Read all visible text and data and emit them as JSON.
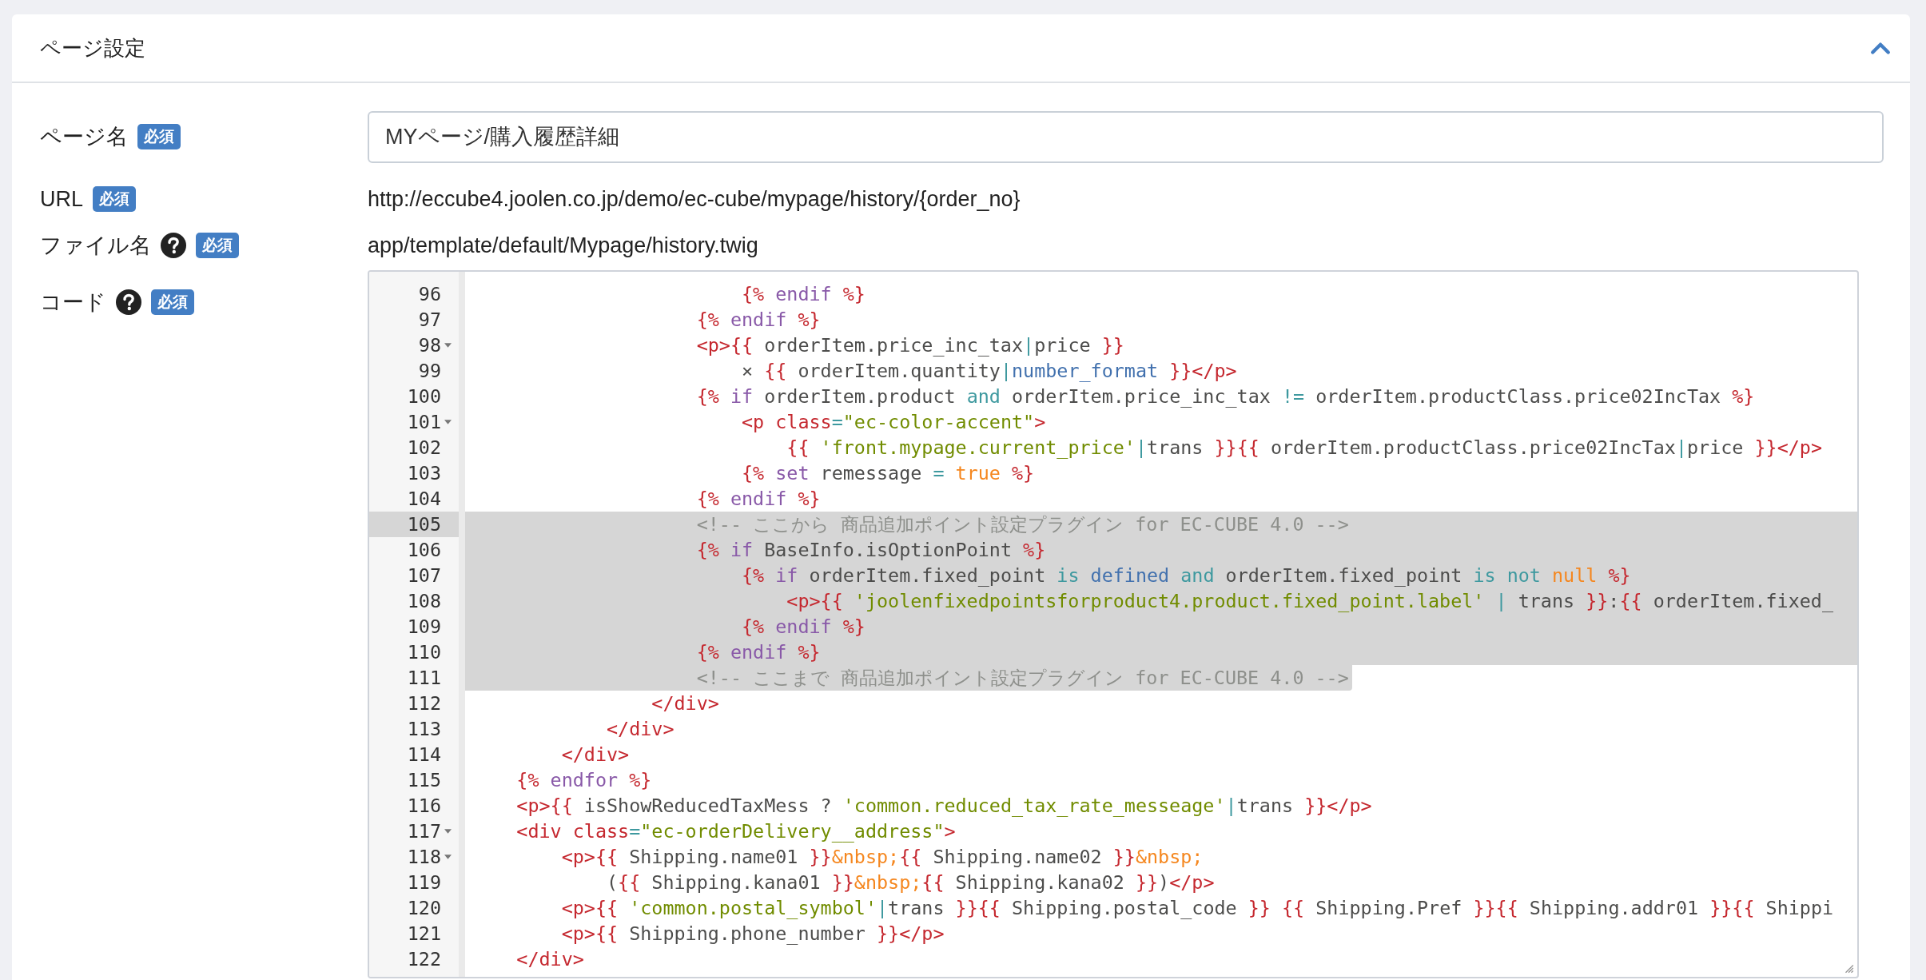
{
  "panel": {
    "title": "ページ設定",
    "expanded": true
  },
  "fields": [
    {
      "label": "ページ名",
      "help": false,
      "badge": "必須",
      "kind": "input",
      "value": "MYページ/購入履歴詳細"
    },
    {
      "label": "URL",
      "help": false,
      "badge": "必須",
      "kind": "text",
      "value": "http://eccube4.joolen.co.jp/demo/ec-cube/mypage/history/{order_no}"
    },
    {
      "label": "ファイル名",
      "help": true,
      "badge": "必須",
      "kind": "text",
      "value": "app/template/default/Mypage/history.twig"
    },
    {
      "label": "コード",
      "help": true,
      "badge": "必須",
      "kind": "code"
    }
  ],
  "editor": {
    "lines": [
      {
        "number": "96",
        "foldable": false,
        "active": false,
        "selected": false,
        "tokens": [
          {
            "kind": "tag",
            "text": "                        {%"
          },
          {
            "kind": "keyword",
            "text": " endif "
          },
          {
            "kind": "tag",
            "text": "%}"
          }
        ]
      },
      {
        "number": "97",
        "foldable": false,
        "active": false,
        "selected": false,
        "tokens": [
          {
            "kind": "tag",
            "text": "                    {%"
          },
          {
            "kind": "keyword",
            "text": " endif "
          },
          {
            "kind": "tag",
            "text": "%}"
          }
        ]
      },
      {
        "number": "98",
        "foldable": true,
        "active": false,
        "selected": false,
        "tokens": [
          {
            "kind": "tag",
            "text": "                    <p>{{"
          },
          {
            "kind": "plain",
            "text": " orderItem.price_inc_tax"
          },
          {
            "kind": "op",
            "text": "|"
          },
          {
            "kind": "plain",
            "text": "price "
          },
          {
            "kind": "tag",
            "text": "}}"
          }
        ]
      },
      {
        "number": "99",
        "foldable": false,
        "active": false,
        "selected": false,
        "tokens": [
          {
            "kind": "plain",
            "text": "                        × "
          },
          {
            "kind": "tag",
            "text": "{{"
          },
          {
            "kind": "plain",
            "text": " orderItem.quantity"
          },
          {
            "kind": "op",
            "text": "|"
          },
          {
            "kind": "filter",
            "text": "number_format"
          },
          {
            "kind": "tag",
            "text": " }}</p>"
          }
        ]
      },
      {
        "number": "100",
        "foldable": false,
        "active": false,
        "selected": false,
        "tokens": [
          {
            "kind": "tag",
            "text": "                    {%"
          },
          {
            "kind": "keyword",
            "text": " if "
          },
          {
            "kind": "plain",
            "text": "orderItem.product "
          },
          {
            "kind": "op",
            "text": "and"
          },
          {
            "kind": "plain",
            "text": " orderItem.price_inc_tax "
          },
          {
            "kind": "op",
            "text": "!="
          },
          {
            "kind": "plain",
            "text": " orderItem.productClass.price02IncTax "
          },
          {
            "kind": "tag",
            "text": "%}"
          }
        ]
      },
      {
        "number": "101",
        "foldable": true,
        "active": false,
        "selected": false,
        "tokens": [
          {
            "kind": "tag",
            "text": "                        <p class"
          },
          {
            "kind": "op",
            "text": "="
          },
          {
            "kind": "string",
            "text": "\"ec-color-accent\""
          },
          {
            "kind": "tag",
            "text": ">"
          }
        ]
      },
      {
        "number": "102",
        "foldable": false,
        "active": false,
        "selected": false,
        "tokens": [
          {
            "kind": "tag",
            "text": "                            {{"
          },
          {
            "kind": "string",
            "text": " 'front.mypage.current_price'"
          },
          {
            "kind": "op",
            "text": "|"
          },
          {
            "kind": "plain",
            "text": "trans "
          },
          {
            "kind": "tag",
            "text": "}}{{"
          },
          {
            "kind": "plain",
            "text": " orderItem.productClass.price02IncTax"
          },
          {
            "kind": "op",
            "text": "|"
          },
          {
            "kind": "plain",
            "text": "price "
          },
          {
            "kind": "tag",
            "text": "}}</p>"
          }
        ]
      },
      {
        "number": "103",
        "foldable": false,
        "active": false,
        "selected": false,
        "tokens": [
          {
            "kind": "tag",
            "text": "                        {%"
          },
          {
            "kind": "keyword",
            "text": " set "
          },
          {
            "kind": "plain",
            "text": "remessage "
          },
          {
            "kind": "op",
            "text": "="
          },
          {
            "kind": "const",
            "text": " true "
          },
          {
            "kind": "tag",
            "text": "%}"
          }
        ]
      },
      {
        "number": "104",
        "foldable": false,
        "active": false,
        "selected": false,
        "tokens": [
          {
            "kind": "tag",
            "text": "                    {%"
          },
          {
            "kind": "keyword",
            "text": " endif "
          },
          {
            "kind": "tag",
            "text": "%}"
          }
        ]
      },
      {
        "number": "105",
        "foldable": false,
        "active": true,
        "selected": true,
        "selection_to_line_end": true,
        "tokens": [
          {
            "kind": "comment",
            "text": "                    <!-- ここから 商品追加ポイント設定プラグイン for EC-CUBE 4.0 -->"
          }
        ]
      },
      {
        "number": "106",
        "foldable": false,
        "active": false,
        "selected": true,
        "selection_to_line_end": true,
        "tokens": [
          {
            "kind": "tag",
            "text": "                    {%"
          },
          {
            "kind": "keyword",
            "text": " if "
          },
          {
            "kind": "plain",
            "text": "BaseInfo.isOptionPoint "
          },
          {
            "kind": "tag",
            "text": "%}"
          }
        ]
      },
      {
        "number": "107",
        "foldable": false,
        "active": false,
        "selected": true,
        "selection_to_line_end": true,
        "tokens": [
          {
            "kind": "tag",
            "text": "                        {%"
          },
          {
            "kind": "keyword",
            "text": " if "
          },
          {
            "kind": "plain",
            "text": "orderItem.fixed_point "
          },
          {
            "kind": "op",
            "text": "is"
          },
          {
            "kind": "filter",
            "text": " defined "
          },
          {
            "kind": "op",
            "text": "and"
          },
          {
            "kind": "plain",
            "text": " orderItem.fixed_point "
          },
          {
            "kind": "op",
            "text": "is not"
          },
          {
            "kind": "const",
            "text": " null "
          },
          {
            "kind": "tag",
            "text": "%}"
          }
        ]
      },
      {
        "number": "108",
        "foldable": false,
        "active": false,
        "selected": true,
        "selection_to_line_end": true,
        "tokens": [
          {
            "kind": "tag",
            "text": "                            <p>{{"
          },
          {
            "kind": "string",
            "text": " 'joolenfixedpointsforproduct4.product.fixed_point.label' "
          },
          {
            "kind": "op",
            "text": "|"
          },
          {
            "kind": "plain",
            "text": " trans "
          },
          {
            "kind": "tag",
            "text": "}}"
          },
          {
            "kind": "plain",
            "text": ":"
          },
          {
            "kind": "tag",
            "text": "{{"
          },
          {
            "kind": "plain",
            "text": " orderItem.fixed_"
          }
        ]
      },
      {
        "number": "109",
        "foldable": false,
        "active": false,
        "selected": true,
        "selection_to_line_end": true,
        "tokens": [
          {
            "kind": "tag",
            "text": "                        {%"
          },
          {
            "kind": "keyword",
            "text": " endif "
          },
          {
            "kind": "tag",
            "text": "%}"
          }
        ]
      },
      {
        "number": "110",
        "foldable": false,
        "active": false,
        "selected": true,
        "selection_to_line_end": true,
        "tokens": [
          {
            "kind": "tag",
            "text": "                    {%"
          },
          {
            "kind": "keyword",
            "text": " endif "
          },
          {
            "kind": "tag",
            "text": "%}"
          }
        ]
      },
      {
        "number": "111",
        "foldable": false,
        "active": false,
        "selected": true,
        "selection_to_line_end": false,
        "tokens": [
          {
            "kind": "comment",
            "text": "                    <!-- ここまで 商品追加ポイント設定プラグイン for EC-CUBE 4.0 -->"
          }
        ]
      },
      {
        "number": "112",
        "foldable": false,
        "active": false,
        "selected": false,
        "tokens": [
          {
            "kind": "tag",
            "text": "                </div>"
          }
        ]
      },
      {
        "number": "113",
        "foldable": false,
        "active": false,
        "selected": false,
        "tokens": [
          {
            "kind": "tag",
            "text": "            </div>"
          }
        ]
      },
      {
        "number": "114",
        "foldable": false,
        "active": false,
        "selected": false,
        "tokens": [
          {
            "kind": "tag",
            "text": "        </div>"
          }
        ]
      },
      {
        "number": "115",
        "foldable": false,
        "active": false,
        "selected": false,
        "tokens": [
          {
            "kind": "tag",
            "text": "    {%"
          },
          {
            "kind": "keyword",
            "text": " endfor "
          },
          {
            "kind": "tag",
            "text": "%}"
          }
        ]
      },
      {
        "number": "116",
        "foldable": false,
        "active": false,
        "selected": false,
        "tokens": [
          {
            "kind": "tag",
            "text": "    <p>{{"
          },
          {
            "kind": "plain",
            "text": " isShowReducedTaxMess ? "
          },
          {
            "kind": "string",
            "text": "'common.reduced_tax_rate_messeage'"
          },
          {
            "kind": "op",
            "text": "|"
          },
          {
            "kind": "plain",
            "text": "trans "
          },
          {
            "kind": "tag",
            "text": "}}</p>"
          }
        ]
      },
      {
        "number": "117",
        "foldable": true,
        "active": false,
        "selected": false,
        "tokens": [
          {
            "kind": "tag",
            "text": "    <div class"
          },
          {
            "kind": "op",
            "text": "="
          },
          {
            "kind": "string",
            "text": "\"ec-orderDelivery__address\""
          },
          {
            "kind": "tag",
            "text": ">"
          }
        ]
      },
      {
        "number": "118",
        "foldable": true,
        "active": false,
        "selected": false,
        "tokens": [
          {
            "kind": "tag",
            "text": "        <p>{{"
          },
          {
            "kind": "plain",
            "text": " Shipping.name01 "
          },
          {
            "kind": "tag",
            "text": "}}"
          },
          {
            "kind": "const",
            "text": "&nbsp;"
          },
          {
            "kind": "tag",
            "text": "{{"
          },
          {
            "kind": "plain",
            "text": " Shipping.name02 "
          },
          {
            "kind": "tag",
            "text": "}}"
          },
          {
            "kind": "const",
            "text": "&nbsp;"
          }
        ]
      },
      {
        "number": "119",
        "foldable": false,
        "active": false,
        "selected": false,
        "tokens": [
          {
            "kind": "plain",
            "text": "            ("
          },
          {
            "kind": "tag",
            "text": "{{"
          },
          {
            "kind": "plain",
            "text": " Shipping.kana01 "
          },
          {
            "kind": "tag",
            "text": "}}"
          },
          {
            "kind": "const",
            "text": "&nbsp;"
          },
          {
            "kind": "tag",
            "text": "{{"
          },
          {
            "kind": "plain",
            "text": " Shipping.kana02 "
          },
          {
            "kind": "tag",
            "text": "}}"
          },
          {
            "kind": "plain",
            "text": ")"
          },
          {
            "kind": "tag",
            "text": "</p>"
          }
        ]
      },
      {
        "number": "120",
        "foldable": false,
        "active": false,
        "selected": false,
        "tokens": [
          {
            "kind": "tag",
            "text": "        <p>{{"
          },
          {
            "kind": "string",
            "text": " 'common.postal_symbol'"
          },
          {
            "kind": "op",
            "text": "|"
          },
          {
            "kind": "plain",
            "text": "trans "
          },
          {
            "kind": "tag",
            "text": "}}{{"
          },
          {
            "kind": "plain",
            "text": " Shipping.postal_code "
          },
          {
            "kind": "tag",
            "text": "}} {{"
          },
          {
            "kind": "plain",
            "text": " Shipping.Pref "
          },
          {
            "kind": "tag",
            "text": "}}{{"
          },
          {
            "kind": "plain",
            "text": " Shipping.addr01 "
          },
          {
            "kind": "tag",
            "text": "}}{{"
          },
          {
            "kind": "plain",
            "text": " Shippi"
          }
        ]
      },
      {
        "number": "121",
        "foldable": false,
        "active": false,
        "selected": false,
        "tokens": [
          {
            "kind": "tag",
            "text": "        <p>{{"
          },
          {
            "kind": "plain",
            "text": " Shipping.phone_number "
          },
          {
            "kind": "tag",
            "text": "}}</p>"
          }
        ]
      },
      {
        "number": "122",
        "foldable": false,
        "active": false,
        "selected": false,
        "tokens": [
          {
            "kind": "tag",
            "text": "    </div>"
          }
        ]
      }
    ]
  }
}
